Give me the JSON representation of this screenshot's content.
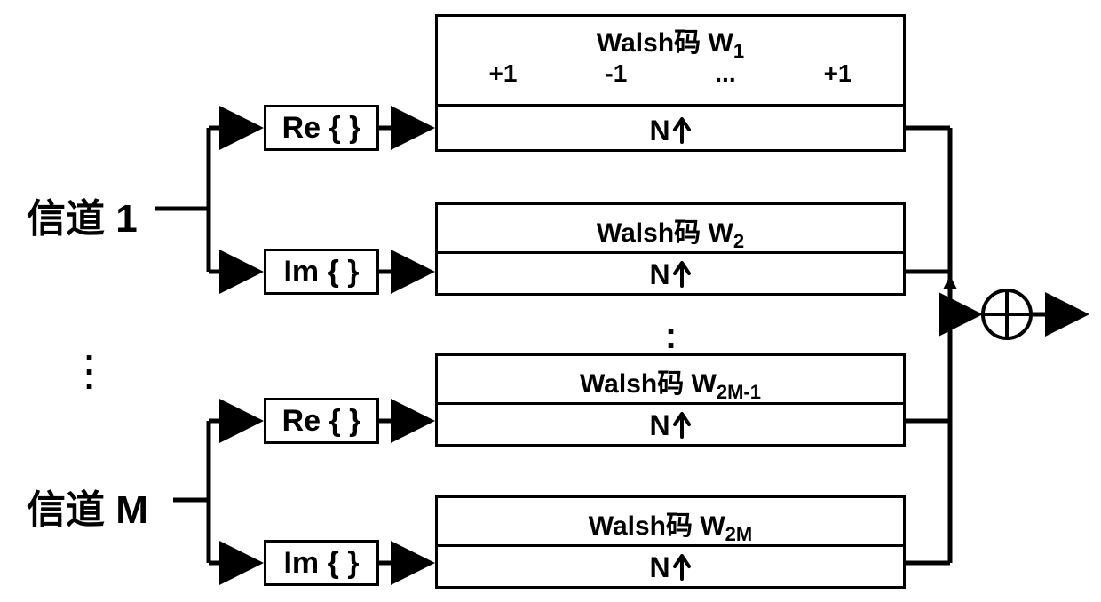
{
  "channels": {
    "ch1_label": "信道 1",
    "chM_label": "信道 M"
  },
  "ops": {
    "re_label": "Re { }",
    "im_label": "Im { }"
  },
  "walsh": {
    "prefix": "Walsh码 W",
    "sub1": "1",
    "sub2": "2",
    "sub3": "2M-1",
    "sub4": "2M",
    "chips": {
      "a": "+1",
      "b": "-1",
      "c": "...",
      "d": "+1"
    },
    "n_label": "N"
  },
  "chart_data": {
    "type": "diagram",
    "description": "CDMA-like multi-channel spreading block diagram. Each channel k (k=1..M) is split into real and imaginary parts, each upsampled by N and spread by a distinct Walsh code W_{2k-1} (real) and W_{2k} (imag). All 2M spread streams are summed at the output.",
    "channels": "M",
    "per_channel_ops": [
      "Re{}",
      "Im{}"
    ],
    "spreading_codes": [
      "W_1",
      "W_2",
      "...",
      "W_{2M-1}",
      "W_{2M}"
    ],
    "example_walsh_chips": [
      "+1",
      "-1",
      "...",
      "+1"
    ],
    "upsample_factor": "N",
    "combiner": "sum",
    "output_arrows": 1
  }
}
